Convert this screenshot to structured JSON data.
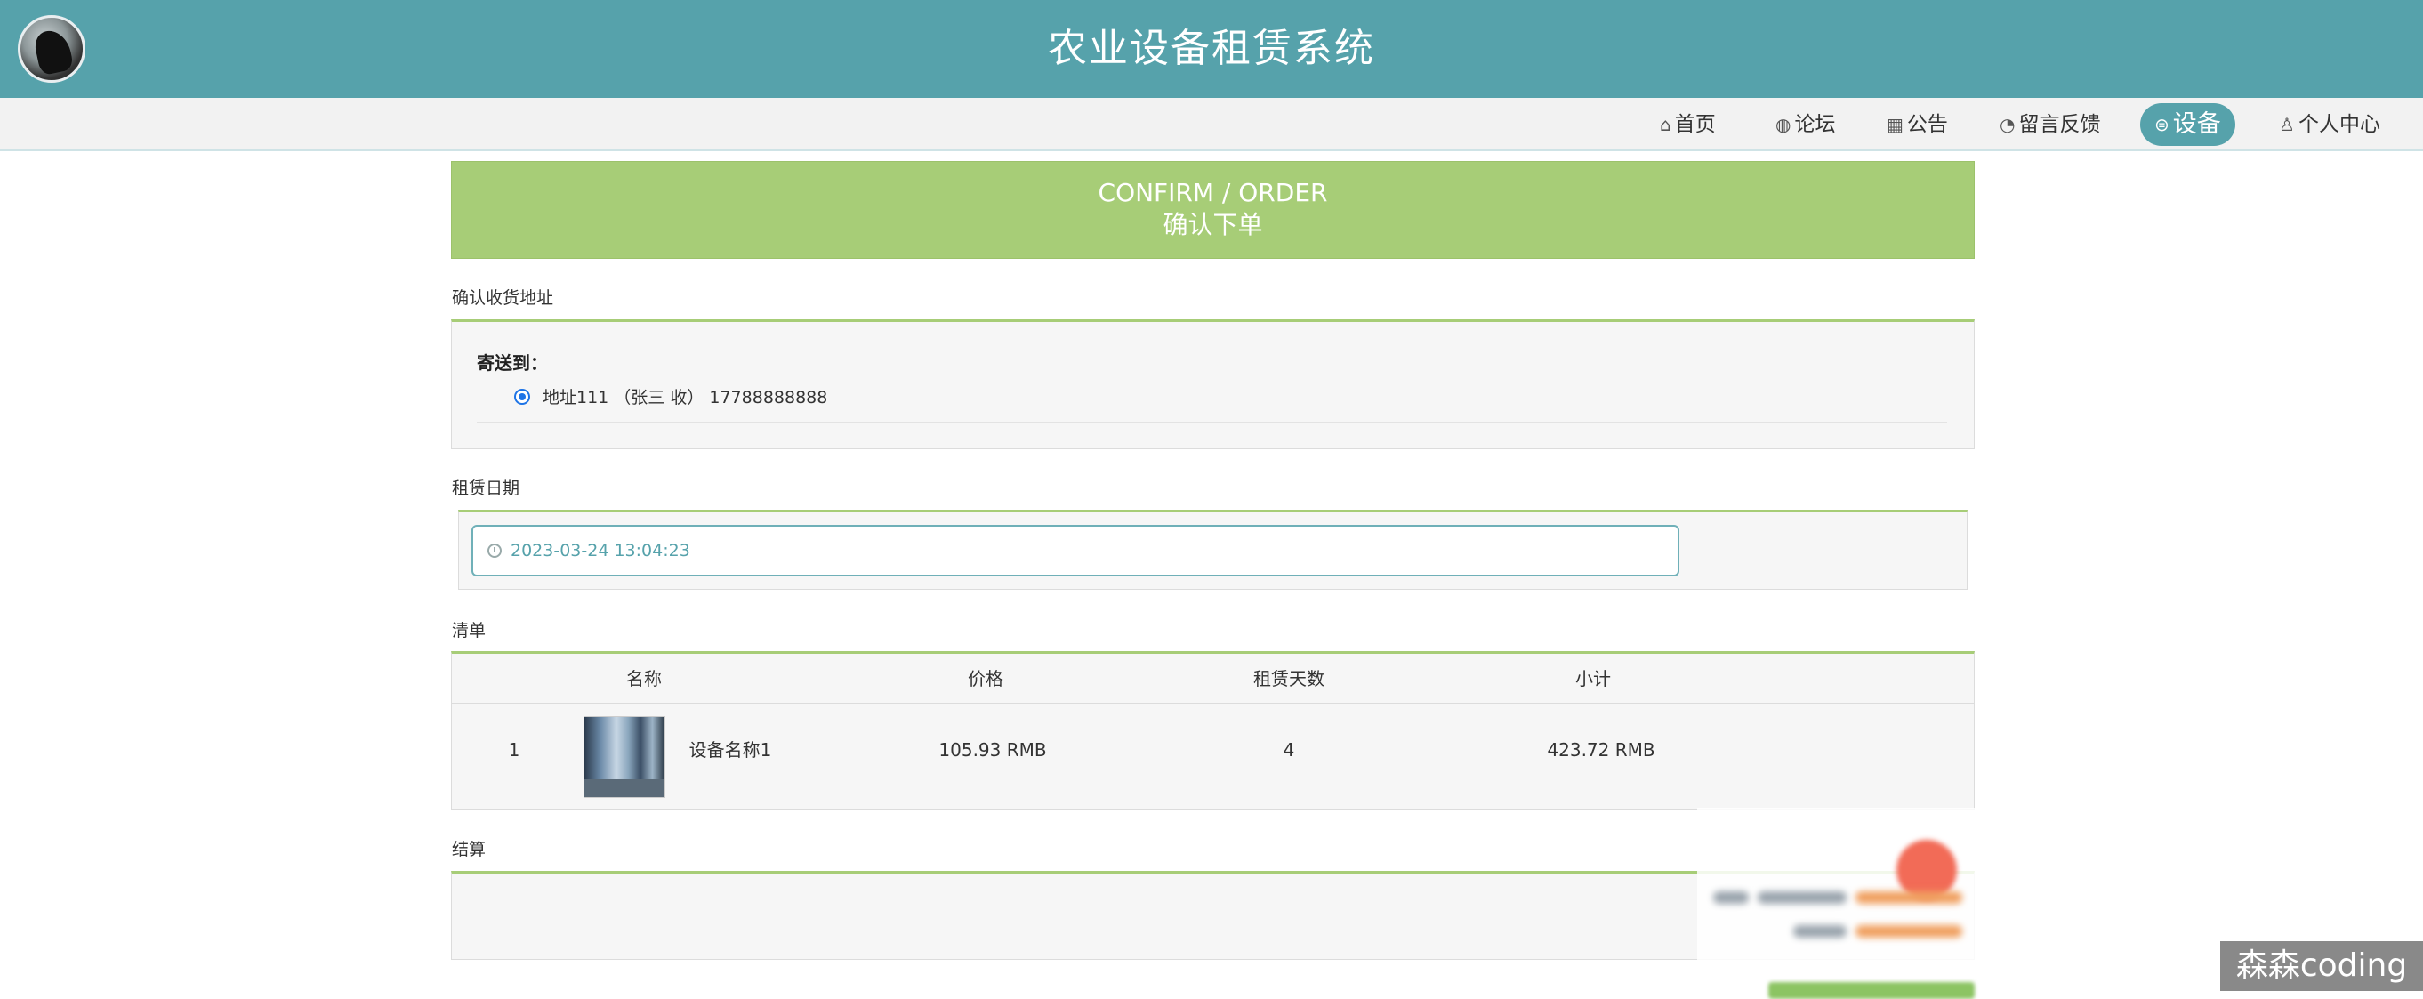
{
  "header": {
    "title": "农业设备租赁系统"
  },
  "nav": {
    "items": [
      {
        "label": "首页",
        "icon": "home-icon",
        "glyph": "⌂"
      },
      {
        "label": "论坛",
        "icon": "globe-icon",
        "glyph": "◍"
      },
      {
        "label": "公告",
        "icon": "notice-icon",
        "glyph": "▦"
      },
      {
        "label": "留言反馈",
        "icon": "speedometer-icon",
        "glyph": "◔"
      },
      {
        "label": "设备",
        "icon": "device-icon",
        "glyph": "⊜",
        "active": true
      },
      {
        "label": "个人中心",
        "icon": "user-icon",
        "glyph": "♙"
      }
    ]
  },
  "banner": {
    "title_en": "CONFIRM / ORDER",
    "title_cn": "确认下单"
  },
  "address": {
    "section_title": "确认收货地址",
    "label": "寄送到：",
    "value": "地址111 （张三 收） 17788888888"
  },
  "rental_date": {
    "section_title": "租赁日期",
    "value": "2023-03-24 13:04:23"
  },
  "order_list": {
    "section_title": "清单",
    "headers": [
      "名称",
      "价格",
      "租赁天数",
      "小计"
    ],
    "rows": [
      {
        "index": "1",
        "name": "设备名称1",
        "price": "105.93 RMB",
        "days": "4",
        "subtotal": "423.72 RMB"
      }
    ]
  },
  "settlement": {
    "section_title": "结算"
  },
  "watermark": {
    "text": "森森coding"
  },
  "colors": {
    "header": "#56a2ab",
    "banner": "#a7cd77",
    "accent_border": "#a7cd77",
    "nav_bg": "#f2f2f2"
  }
}
